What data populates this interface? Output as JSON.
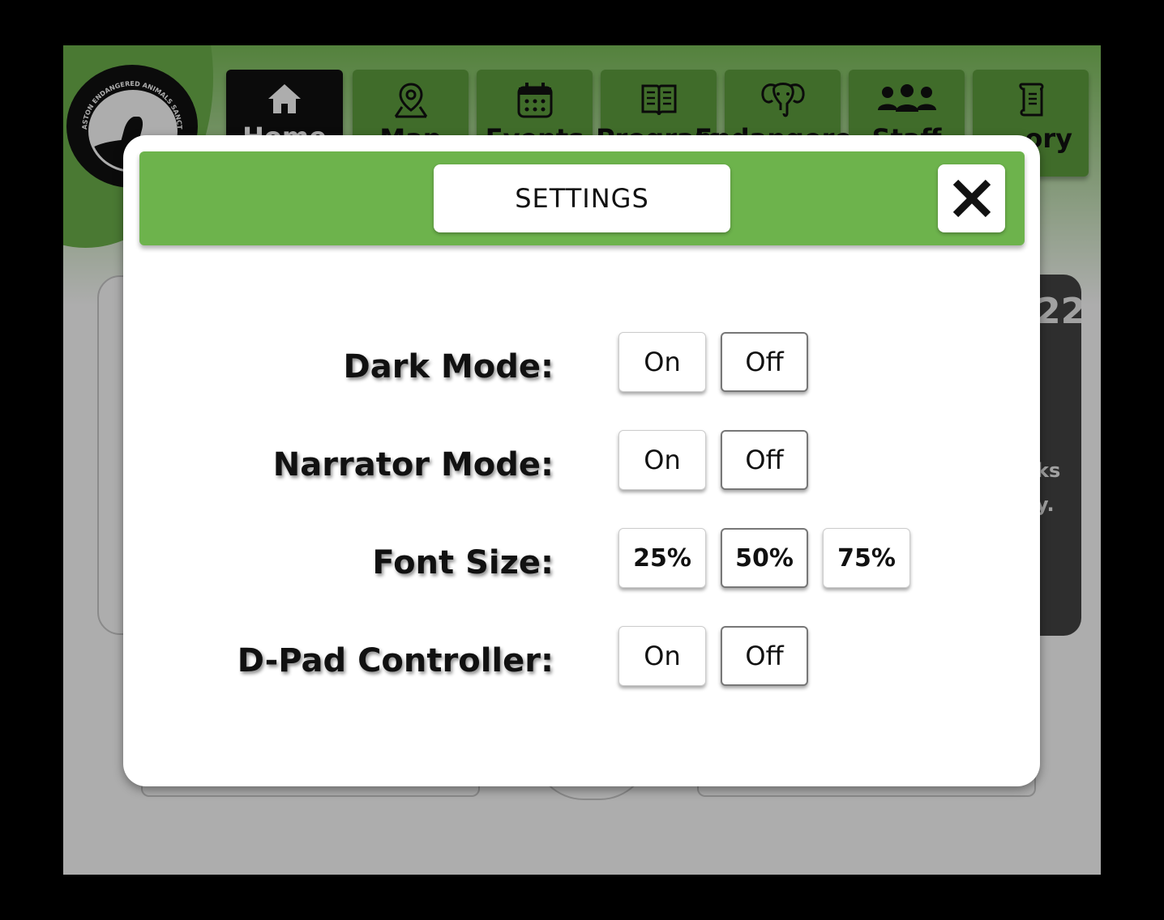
{
  "logo": {
    "text": "ASTON ENDANGERED ANIMALS SANCTUARY"
  },
  "nav": {
    "tabs": [
      {
        "label": "Home",
        "icon": "home-icon"
      },
      {
        "label": "Map",
        "icon": "map-pin-icon"
      },
      {
        "label": "Events",
        "icon": "calendar-icon"
      },
      {
        "label": "Program",
        "icon": "book-icon"
      },
      {
        "label": "Endangered",
        "icon": "elephant-icon"
      },
      {
        "label": "Staff",
        "icon": "people-icon"
      },
      {
        "label": "History",
        "icon": "scroll-icon"
      }
    ],
    "visible_history": "ory"
  },
  "background": {
    "card_number": "22",
    "card_line1": "ks",
    "card_line2": "y."
  },
  "modal": {
    "title": "SETTINGS",
    "close_icon": "close-icon",
    "rows": [
      {
        "label": "Dark Mode:",
        "options": [
          "On",
          "Off"
        ]
      },
      {
        "label": "Narrator Mode:",
        "options": [
          "On",
          "Off"
        ]
      },
      {
        "label": "Font Size:",
        "options": [
          "25%",
          "50%",
          "75%"
        ]
      },
      {
        "label": "D-Pad Controller:",
        "options": [
          "On",
          "Off"
        ]
      }
    ]
  },
  "colors": {
    "accent_green": "#6db34c",
    "nav_green": "#5f9f3f",
    "nav_active": "#111111"
  }
}
